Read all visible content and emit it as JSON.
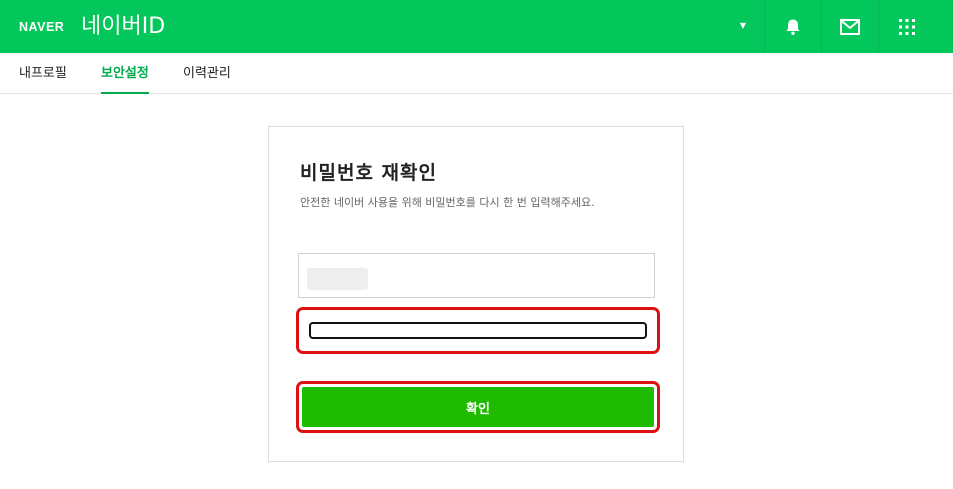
{
  "header": {
    "brand": "NAVER",
    "title": "네이버ID",
    "account_menu_icon": "chevron-down-icon",
    "icons": [
      "bell-icon",
      "mail-icon",
      "apps-grid-icon"
    ],
    "background_color": "#03c75a"
  },
  "tabs": [
    {
      "label": "내프로필",
      "active": false
    },
    {
      "label": "보안설정",
      "active": true
    },
    {
      "label": "이력관리",
      "active": false
    }
  ],
  "panel": {
    "title": "비밀번호 재확인",
    "description": "안전한 네이버 사용을 위해 비밀번호를 다시 한 번 입력해주세요.",
    "id_field": {
      "value": ""
    },
    "password_field": {
      "value": "",
      "placeholder": ""
    },
    "confirm_label": "확인",
    "confirm_color": "#1fbb00",
    "highlight_color": "#dd1111"
  }
}
